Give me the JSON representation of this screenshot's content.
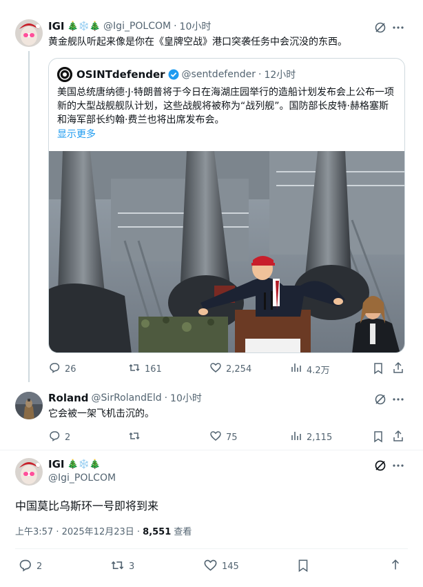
{
  "tweet1": {
    "name": "IGI",
    "emoji": "🎄❄️🎄",
    "handle": "@Igi_POLCOM",
    "time": "10小时",
    "text": "黄金舰队听起来像是你在《皇牌空战》港口突袭任务中会沉没的东西。",
    "quote": {
      "name": "OSINTdefender",
      "handle": "@sentdefender",
      "time": "12小时",
      "text": "美国总统唐纳德·J·特朗普将于今日在海湖庄园举行的造船计划发布会上公布一项新的大型战舰舰队计划，这些战舰将被称为“战列舰”。国防部长皮特·赫格塞斯和海军部长约翰·费兰也将出席发布会。",
      "show_more": "显示更多"
    },
    "stats": {
      "replies": "26",
      "retweets": "161",
      "likes": "2,254",
      "views": "4.2万"
    }
  },
  "tweet2": {
    "name": "Roland",
    "handle": "@SirRolandEld",
    "time": "10小时",
    "text": "它会被一架飞机击沉的。",
    "stats": {
      "replies": "2",
      "retweets": "",
      "likes": "75",
      "views": "2,115"
    }
  },
  "main_tweet": {
    "name": "IGI",
    "emoji": "🎄❄️🎄",
    "handle": "@Igi_POLCOM",
    "text": "中国莫比乌斯环一号即将到来",
    "timestamp": "上午3:57 · 2025年12月23日 · ",
    "views_count": "8,551",
    "views_label": " 查看",
    "stats": {
      "replies": "2",
      "retweets": "3",
      "likes": "145"
    }
  },
  "colors": {
    "accent": "#1d9bf0",
    "muted": "#536471",
    "border": "#cfd9de"
  },
  "icons": [
    "grok-icon",
    "more-icon",
    "verified-badge-icon",
    "reply-icon",
    "retweet-icon",
    "like-icon",
    "views-icon",
    "bookmark-icon",
    "share-icon"
  ]
}
